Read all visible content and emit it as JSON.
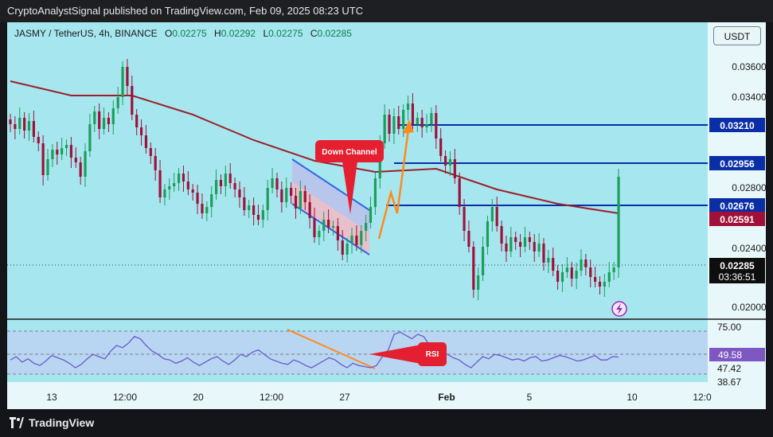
{
  "header": {
    "publisher_text": "CryptoAnalystSignal published on TradingView.com, Feb 09, 2025 08:23 UTC"
  },
  "legend": {
    "symbol": "JASMY / TetherUS, 4h, BINANCE",
    "open_label": "O",
    "open": "0.02275",
    "high_label": "H",
    "high": "0.02292",
    "low_label": "L",
    "low": "0.02275",
    "close_label": "C",
    "close": "0.02285"
  },
  "currency_button": "USDT",
  "footer": {
    "brand": "TradingView"
  },
  "colors": {
    "background": "#a6e7ef",
    "bull": "#1b9e5a",
    "bear": "#a0113a",
    "ma": "#9c1f2a",
    "level": "#0a2ea6",
    "arrow": "#ff8a1c",
    "label": "#e31f30"
  },
  "chart_data": {
    "type": "candlestick",
    "symbol": "JASMY/USDT",
    "timeframe": "4h",
    "ylim": [
      0.0196,
      0.0372
    ],
    "price_axis_ticks": [
      "0.03600",
      "0.03400",
      "0.03200",
      "0.03000",
      "0.02800",
      "0.02400",
      "0.02000"
    ],
    "time_axis_ticks": [
      "13",
      "12:00",
      "20",
      "12:00",
      "27",
      "Feb",
      "5",
      "10",
      "12:0"
    ],
    "levels": [
      {
        "price": 0.0321,
        "label": "0.03210"
      },
      {
        "price": 0.02956,
        "label": "0.02956"
      },
      {
        "price": 0.02676,
        "label": "0.02676"
      }
    ],
    "moving_average_label": "0.02591",
    "last_price": {
      "price": 0.02285,
      "label": "0.02285",
      "countdown": "03:36:51"
    },
    "annotations": {
      "channel": "Down Channel",
      "rsi_tag": "RSI"
    },
    "price_series": {
      "start": 0.0321,
      "closes": [
        0.0318,
        0.0315,
        0.0322,
        0.0314,
        0.032,
        0.031,
        0.0306,
        0.0286,
        0.0296,
        0.0302,
        0.0299,
        0.0303,
        0.0305,
        0.0297,
        0.0294,
        0.0285,
        0.0301,
        0.0318,
        0.0326,
        0.0315,
        0.0322,
        0.0318,
        0.0328,
        0.0335,
        0.0354,
        0.0342,
        0.0324,
        0.0316,
        0.0311,
        0.0303,
        0.0298,
        0.0289,
        0.0272,
        0.0277,
        0.0279,
        0.0281,
        0.0287,
        0.0282,
        0.0277,
        0.0275,
        0.0268,
        0.0262,
        0.0266,
        0.0274,
        0.0283,
        0.0279,
        0.0287,
        0.0281,
        0.0277,
        0.0272,
        0.0264,
        0.0267,
        0.0261,
        0.0258,
        0.0264,
        0.0278,
        0.0284,
        0.0277,
        0.0269,
        0.0278,
        0.0273,
        0.0265,
        0.0276,
        0.0269,
        0.0259,
        0.0247,
        0.0251,
        0.0258,
        0.0253,
        0.0254,
        0.0245,
        0.0236,
        0.0243,
        0.0248,
        0.0242,
        0.0251,
        0.0256,
        0.0266,
        0.0284,
        0.0306,
        0.0324,
        0.0312,
        0.0323,
        0.0315,
        0.0327,
        0.0331,
        0.0318,
        0.0322,
        0.0316,
        0.0318,
        0.0325,
        0.0309,
        0.0298,
        0.0292,
        0.0296,
        0.0284,
        0.0266,
        0.0251,
        0.0241,
        0.0214,
        0.0223,
        0.0241,
        0.0257,
        0.0266,
        0.0254,
        0.0243,
        0.0238,
        0.0247,
        0.0244,
        0.0241,
        0.0247,
        0.0244,
        0.0238,
        0.0243,
        0.0231,
        0.0234,
        0.0226,
        0.0219,
        0.0225,
        0.0228,
        0.0221,
        0.0226,
        0.0233,
        0.0228,
        0.0222,
        0.0219,
        0.0216,
        0.0219,
        0.0225,
        0.0228,
        0.0285
      ]
    },
    "moving_average": {
      "x": [
        0,
        0.1,
        0.2,
        0.3,
        0.4,
        0.5,
        0.6,
        0.7,
        0.8,
        0.9,
        1.0
      ],
      "y": [
        0.0345,
        0.0336,
        0.0336,
        0.0324,
        0.0308,
        0.0295,
        0.0288,
        0.029,
        0.0277,
        0.0268,
        0.0262
      ]
    },
    "rsi": {
      "ticks": [
        "75.00",
        "49.58",
        "47.42",
        "38.67"
      ],
      "values": [
        47,
        50,
        45,
        48,
        44,
        42,
        46,
        51,
        49,
        47,
        44,
        40,
        43,
        48,
        52,
        50,
        48,
        55,
        60,
        58,
        62,
        68,
        66,
        60,
        55,
        52,
        48,
        47,
        44,
        46,
        49,
        45,
        42,
        45,
        48,
        50,
        46,
        43,
        47,
        52,
        50,
        54,
        56,
        52,
        48,
        46,
        44,
        43,
        47,
        45,
        42,
        40,
        43,
        46,
        49,
        47,
        43,
        40,
        44,
        42,
        41,
        40,
        42,
        50,
        56,
        70,
        72,
        69,
        66,
        70,
        68,
        60,
        57,
        54,
        52,
        49,
        47,
        43,
        40,
        45,
        50,
        48,
        52,
        51,
        49,
        47,
        48,
        46,
        49,
        50,
        46,
        47,
        49,
        51,
        50,
        48,
        46,
        47,
        49,
        51,
        47,
        47,
        50,
        49.58
      ]
    }
  }
}
